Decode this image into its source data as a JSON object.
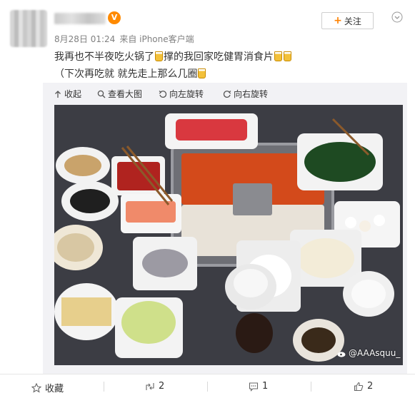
{
  "post": {
    "vip_badge": "V",
    "date": "8月28日 01:24",
    "source": "来自 iPhone客户端",
    "text_line1": "我再也不半夜吃火锅了",
    "text_line1b": "撑的我回家吃健胃消食片",
    "text_line2": "（下次再吃就 就先走上那么几圈",
    "follow_label": "关注"
  },
  "media_toolbar": {
    "collapse": "收起",
    "view_large": "查看大图",
    "rotate_left": "向左旋转",
    "rotate_right": "向右旋转"
  },
  "watermark": "@AAAsquu_",
  "actions": {
    "favorite": "收藏",
    "repost_count": "2",
    "comment_count": "1",
    "like_count": "2"
  },
  "colors": {
    "accent": "#ff8200",
    "toolbar_bg": "#f2f2f5"
  }
}
